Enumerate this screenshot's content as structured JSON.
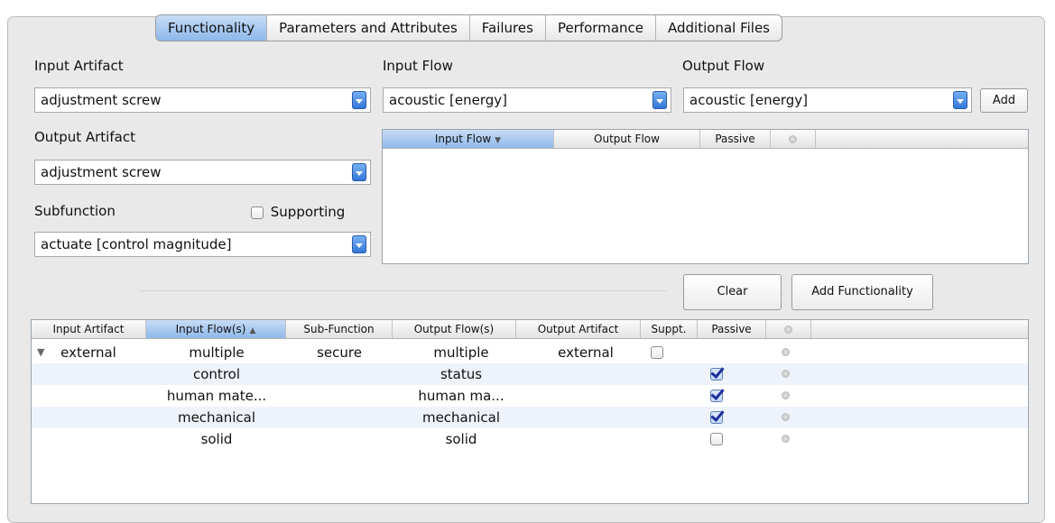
{
  "tabs": {
    "functionality": "Functionality",
    "parameters": "Parameters and Attributes",
    "failures": "Failures",
    "performance": "Performance",
    "files": "Additional Files"
  },
  "form": {
    "input_artifact_label": "Input Artifact",
    "input_artifact_value": "adjustment screw",
    "input_flow_label": "Input Flow",
    "input_flow_value": "acoustic [energy]",
    "output_flow_label": "Output Flow",
    "output_flow_value": "acoustic [energy]",
    "add_label": "Add",
    "output_artifact_label": "Output Artifact",
    "output_artifact_value": "adjustment screw",
    "subfunction_label": "Subfunction",
    "supporting_label": "Supporting",
    "subfunction_value": "actuate [control magnitude]"
  },
  "flow_table": {
    "headers": [
      "Input Flow",
      "Output Flow",
      "Passive"
    ]
  },
  "buttons": {
    "clear": "Clear",
    "add_functionality": "Add Functionality"
  },
  "func_table": {
    "headers": [
      "Input Artifact",
      "Input Flow(s)",
      "Sub-Function",
      "Output Flow(s)",
      "Output Artifact",
      "Suppt.",
      "Passive"
    ],
    "rows": [
      {
        "input_artifact": "external",
        "input_flow": "multiple",
        "sub_function": "secure",
        "output_flow": "multiple",
        "output_artifact": "external",
        "supported": false,
        "passive": null
      },
      {
        "input_artifact": "",
        "input_flow": "control",
        "sub_function": "",
        "output_flow": "status",
        "output_artifact": "",
        "supported": null,
        "passive": true
      },
      {
        "input_artifact": "",
        "input_flow": "human mate...",
        "sub_function": "",
        "output_flow": "human ma...",
        "output_artifact": "",
        "supported": null,
        "passive": true
      },
      {
        "input_artifact": "",
        "input_flow": "mechanical",
        "sub_function": "",
        "output_flow": "mechanical",
        "output_artifact": "",
        "supported": null,
        "passive": true
      },
      {
        "input_artifact": "",
        "input_flow": "solid",
        "sub_function": "",
        "output_flow": "solid",
        "output_artifact": "",
        "supported": null,
        "passive": false
      }
    ]
  }
}
